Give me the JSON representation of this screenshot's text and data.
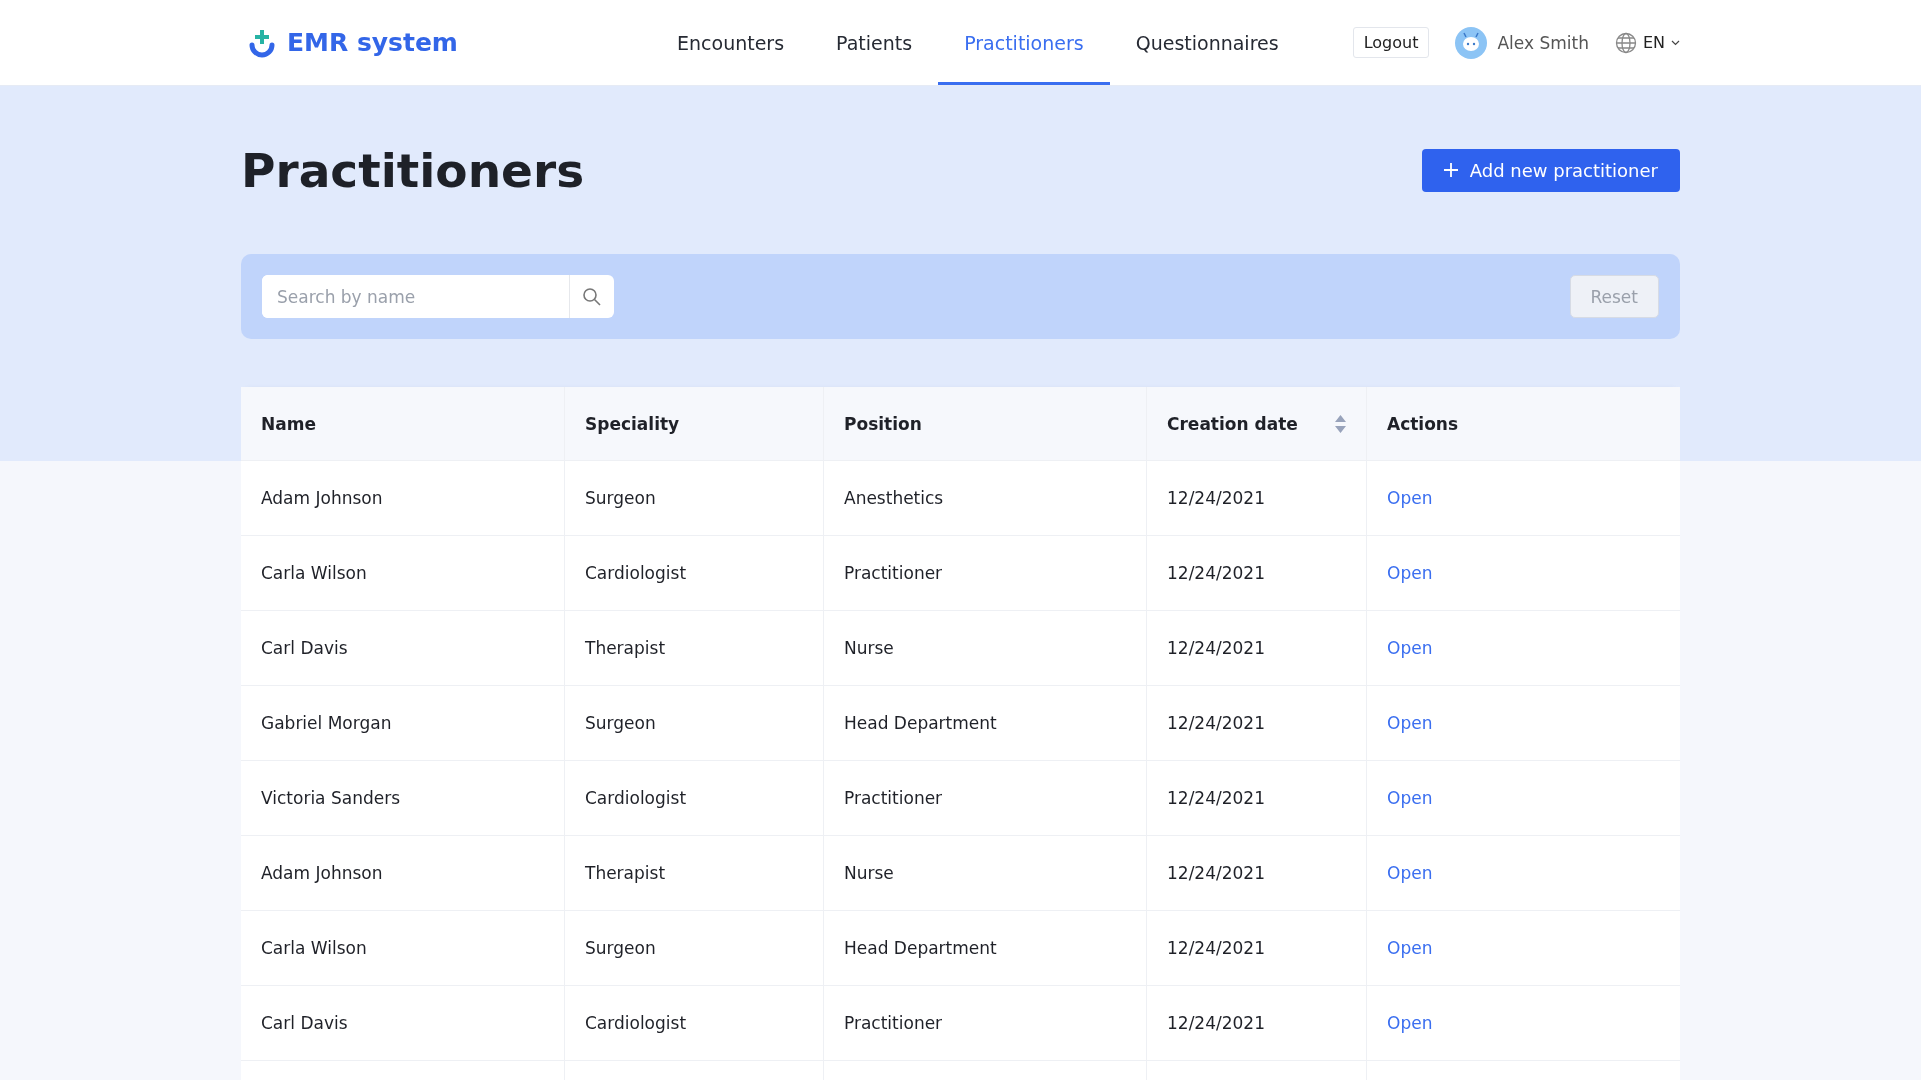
{
  "header": {
    "logo": "EMR system",
    "nav": [
      {
        "label": "Encounters",
        "selected": false
      },
      {
        "label": "Patients",
        "selected": false
      },
      {
        "label": "Practitioners",
        "selected": true
      },
      {
        "label": "Questionnaires",
        "selected": false
      }
    ],
    "logout": "Logout",
    "user": "Alex Smith",
    "language": "EN"
  },
  "page": {
    "title": "Practitioners",
    "add_button": "Add new practitioner"
  },
  "filter": {
    "search": {
      "placeholder": "Search by name"
    },
    "reset": "Reset"
  },
  "table": {
    "columns": [
      {
        "label": "Name"
      },
      {
        "label": "Speciality"
      },
      {
        "label": "Position"
      },
      {
        "label": "Creation date",
        "sort_icon": true
      },
      {
        "label": "Actions"
      }
    ],
    "rows": [
      {
        "name": "Adam Johnson",
        "speciality": "Surgeon",
        "position": "Anesthetics",
        "creation_date": "12/24/2021",
        "action": "Open"
      },
      {
        "name": "Carla Wilson",
        "speciality": "Cardiologist",
        "position": "Practitioner",
        "creation_date": "12/24/2021",
        "action": "Open"
      },
      {
        "name": "Carl Davis",
        "speciality": "Therapist",
        "position": "Nurse",
        "creation_date": "12/24/2021",
        "action": "Open"
      },
      {
        "name": "Gabriel Morgan",
        "speciality": "Surgeon",
        "position": "Head Department",
        "creation_date": "12/24/2021",
        "action": "Open"
      },
      {
        "name": "Victoria Sanders",
        "speciality": "Cardiologist",
        "position": "Practitioner",
        "creation_date": "12/24/2021",
        "action": "Open"
      },
      {
        "name": "Adam Johnson",
        "speciality": "Therapist",
        "position": "Nurse",
        "creation_date": "12/24/2021",
        "action": "Open"
      },
      {
        "name": "Carla Wilson",
        "speciality": "Surgeon",
        "position": "Head Department",
        "creation_date": "12/24/2021",
        "action": "Open"
      },
      {
        "name": "Carl Davis",
        "speciality": "Cardiologist",
        "position": "Practitioner",
        "creation_date": "12/24/2021",
        "action": "Open"
      }
    ]
  }
}
